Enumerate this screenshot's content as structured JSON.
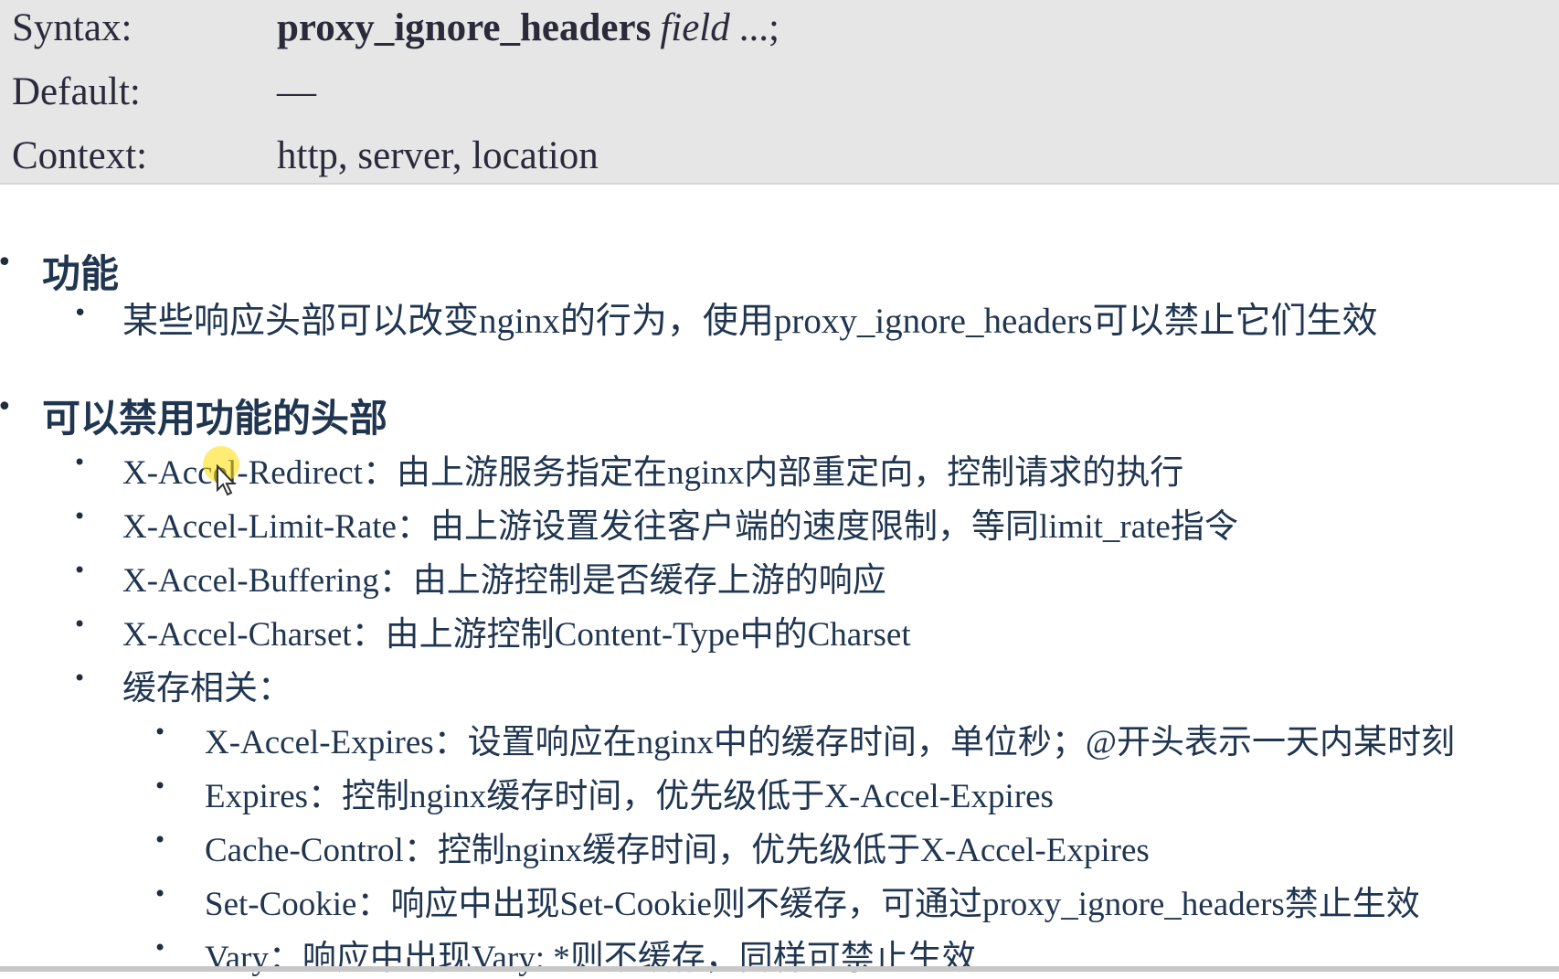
{
  "directive": {
    "syntax_label": "Syntax:",
    "syntax_name": "proxy_ignore_headers",
    "syntax_arg": "field",
    "syntax_rest": "...;",
    "default_label": "Default:",
    "default_value": "—",
    "context_label": "Context:",
    "context_value": "http, server, location"
  },
  "sections": [
    {
      "heading": "功能",
      "items": [
        "某些响应头部可以改变nginx的行为，使用proxy_ignore_headers可以禁止它们生效"
      ]
    },
    {
      "heading": "可以禁用功能的头部",
      "items": [
        "X-Accel-Redirect：由上游服务指定在nginx内部重定向，控制请求的执行",
        "X-Accel-Limit-Rate：由上游设置发往客户端的速度限制，等同limit_rate指令",
        "X-Accel-Buffering：由上游控制是否缓存上游的响应",
        "X-Accel-Charset：由上游控制Content-Type中的Charset",
        "缓存相关："
      ],
      "cache_items": [
        "X-Accel-Expires：设置响应在nginx中的缓存时间，单位秒；@开头表示一天内某时刻",
        "Expires：控制nginx缓存时间，优先级低于X-Accel-Expires",
        "Cache-Control：控制nginx缓存时间，优先级低于X-Accel-Expires",
        "Set-Cookie：响应中出现Set-Cookie则不缓存，可通过proxy_ignore_headers禁止生效",
        "Vary：响应中出现Vary: *则不缓存，同样可禁止生效"
      ]
    }
  ]
}
